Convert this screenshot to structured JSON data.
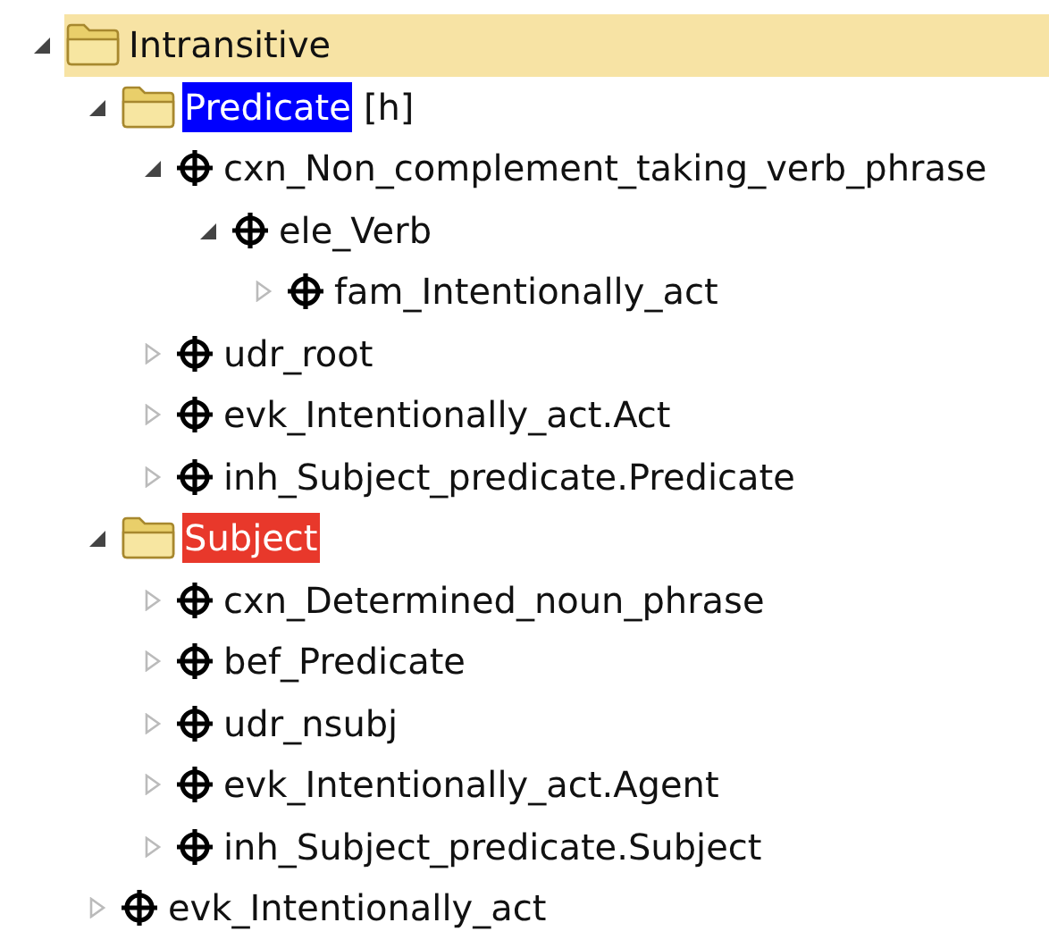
{
  "tree": [
    {
      "kind": "folder",
      "label": "Intransitive",
      "expanded": true,
      "selected": true,
      "children": [
        {
          "kind": "folder",
          "label": "Predicate",
          "suffix": "[h]",
          "color": "#0000ff",
          "expanded": true,
          "selected": false,
          "children": [
            {
              "kind": "node",
              "label": "cxn_Non_complement_taking_verb_phrase",
              "expanded": true,
              "selected": false,
              "children": [
                {
                  "kind": "node",
                  "label": "ele_Verb",
                  "expanded": true,
                  "selected": false,
                  "children": [
                    {
                      "kind": "node",
                      "label": "fam_Intentionally_act",
                      "expanded": false,
                      "selected": false
                    }
                  ]
                }
              ]
            },
            {
              "kind": "node",
              "label": "udr_root",
              "expanded": false,
              "selected": false
            },
            {
              "kind": "node",
              "label": "evk_Intentionally_act.Act",
              "expanded": false,
              "selected": false
            },
            {
              "kind": "node",
              "label": "inh_Subject_predicate.Predicate",
              "expanded": false,
              "selected": false
            }
          ]
        },
        {
          "kind": "folder",
          "label": "Subject",
          "color": "#e8382b",
          "expanded": true,
          "selected": false,
          "children": [
            {
              "kind": "node",
              "label": "cxn_Determined_noun_phrase",
              "expanded": false,
              "selected": false
            },
            {
              "kind": "node",
              "label": "bef_Predicate",
              "expanded": false,
              "selected": false
            },
            {
              "kind": "node",
              "label": "udr_nsubj",
              "expanded": false,
              "selected": false
            },
            {
              "kind": "node",
              "label": "evk_Intentionally_act.Agent",
              "expanded": false,
              "selected": false
            },
            {
              "kind": "node",
              "label": "inh_Subject_predicate.Subject",
              "expanded": false,
              "selected": false
            }
          ]
        },
        {
          "kind": "node",
          "label": "evk_Intentionally_act",
          "expanded": false,
          "selected": false
        }
      ]
    }
  ]
}
